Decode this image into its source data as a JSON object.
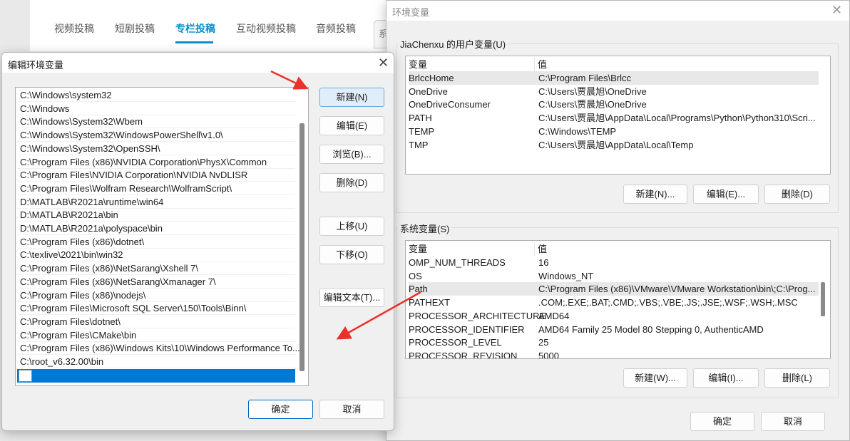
{
  "browser": {
    "tabs": [
      "视频投稿",
      "短剧投稿",
      "专栏投稿",
      "互动视频投稿",
      "音频投稿"
    ],
    "active_tab": 2,
    "partial_tab": "系"
  },
  "edit_dialog": {
    "title": "编辑环境变量",
    "paths": [
      "C:\\Windows\\system32",
      "C:\\Windows",
      "C:\\Windows\\System32\\Wbem",
      "C:\\Windows\\System32\\WindowsPowerShell\\v1.0\\",
      "C:\\Windows\\System32\\OpenSSH\\",
      "C:\\Program Files (x86)\\NVIDIA Corporation\\PhysX\\Common",
      "C:\\Program Files\\NVIDIA Corporation\\NVIDIA NvDLISR",
      "C:\\Program Files\\Wolfram Research\\WolframScript\\",
      "D:\\MATLAB\\R2021a\\runtime\\win64",
      "D:\\MATLAB\\R2021a\\bin",
      "D:\\MATLAB\\R2021a\\polyspace\\bin",
      "C:\\Program Files (x86)\\dotnet\\",
      "C:\\texlive\\2021\\bin\\win32",
      "C:\\Program Files (x86)\\NetSarang\\Xshell 7\\",
      "C:\\Program Files (x86)\\NetSarang\\Xmanager 7\\",
      "C:\\Program Files (x86)\\nodejs\\",
      "C:\\Program Files\\Microsoft SQL Server\\150\\Tools\\Binn\\",
      "C:\\Program Files\\dotnet\\",
      "C:\\Program Files\\CMake\\bin",
      "C:\\Program Files (x86)\\Windows Kits\\10\\Windows Performance To...",
      "C:\\root_v6.32.00\\bin"
    ],
    "new_entry_value": "",
    "buttons": {
      "new": "新建(N)",
      "edit": "编辑(E)",
      "browse": "浏览(B)...",
      "delete": "删除(D)",
      "up": "上移(U)",
      "down": "下移(O)",
      "edit_text": "编辑文本(T)...",
      "ok": "确定",
      "cancel": "取消"
    }
  },
  "env_dialog": {
    "title": "环境变量",
    "user_group": "JiaChenxu 的用户变量(U)",
    "col_var": "变量",
    "col_val": "值",
    "user_vars": [
      [
        "BrlccHome",
        "C:\\Program Files\\Brlcc"
      ],
      [
        "OneDrive",
        "C:\\Users\\贾晨旭\\OneDrive"
      ],
      [
        "OneDriveConsumer",
        "C:\\Users\\贾晨旭\\OneDrive"
      ],
      [
        "PATH",
        "C:\\Users\\贾晨旭\\AppData\\Local\\Programs\\Python\\Python310\\Scri..."
      ],
      [
        "TEMP",
        "C:\\Windows\\TEMP"
      ],
      [
        "TMP",
        "C:\\Users\\贾晨旭\\AppData\\Local\\Temp"
      ]
    ],
    "user_buttons": {
      "new": "新建(N)...",
      "edit": "编辑(E)...",
      "delete": "删除(D)"
    },
    "sys_group": "系统变量(S)",
    "sys_vars": [
      [
        "OMP_NUM_THREADS",
        "16"
      ],
      [
        "OS",
        "Windows_NT"
      ],
      [
        "Path",
        "C:\\Program Files (x86)\\VMware\\VMware Workstation\\bin\\;C:\\Prog..."
      ],
      [
        "PATHEXT",
        ".COM;.EXE;.BAT;.CMD;.VBS;.VBE;.JS;.JSE;.WSF;.WSH;.MSC"
      ],
      [
        "PROCESSOR_ARCHITECTURE",
        "AMD64"
      ],
      [
        "PROCESSOR_IDENTIFIER",
        "AMD64 Family 25 Model 80 Stepping 0, AuthenticAMD"
      ],
      [
        "PROCESSOR_LEVEL",
        "25"
      ],
      [
        "PROCESSOR_REVISION",
        "5000"
      ]
    ],
    "sys_buttons": {
      "new": "新建(W)...",
      "edit": "编辑(I)...",
      "delete": "删除(L)"
    },
    "ok": "确定",
    "cancel": "取消"
  },
  "colors": {
    "accent": "#0078d4",
    "annotation": "#e8322b",
    "tab_active": "#0a8fc9"
  }
}
